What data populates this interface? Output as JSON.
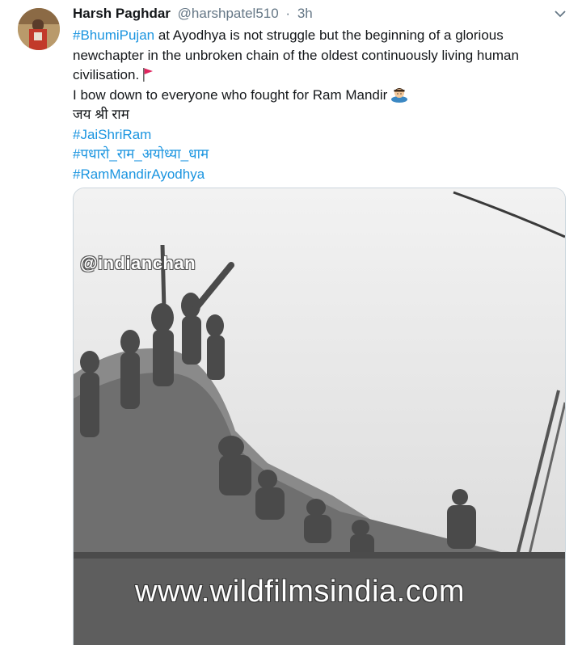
{
  "tweet": {
    "author_name": "Harsh Paghdar",
    "author_handle": "@harshpatel510",
    "separator": "·",
    "timestamp": "3h",
    "lines": [
      {
        "hashtag": "#BhumiPujan",
        "text": " at Ayodhya is not struggle but the beginning of a glorious"
      },
      {
        "text": "newchapter in the unbroken chain of the oldest continuously living human"
      },
      {
        "text": "civilisation."
      },
      {
        "text": "I bow down to everyone who fought for Ram Mandir"
      },
      {
        "text": "जय श्री राम"
      }
    ],
    "hashtags": [
      "#JaiShriRam",
      "#पधारो_राम_अयोध्या_धाम",
      "#RamMandirAyodhya"
    ],
    "emojis": {
      "line3": "triangular-flag-icon",
      "line4": "person-bowing-icon"
    }
  },
  "media": {
    "watermark_top": "@indianchan",
    "watermark_bottom": "www.wildfilmsindia.com"
  },
  "colors": {
    "link": "#1b95e0",
    "muted": "#657786",
    "text": "#14171a",
    "border": "#ccd6dd"
  }
}
